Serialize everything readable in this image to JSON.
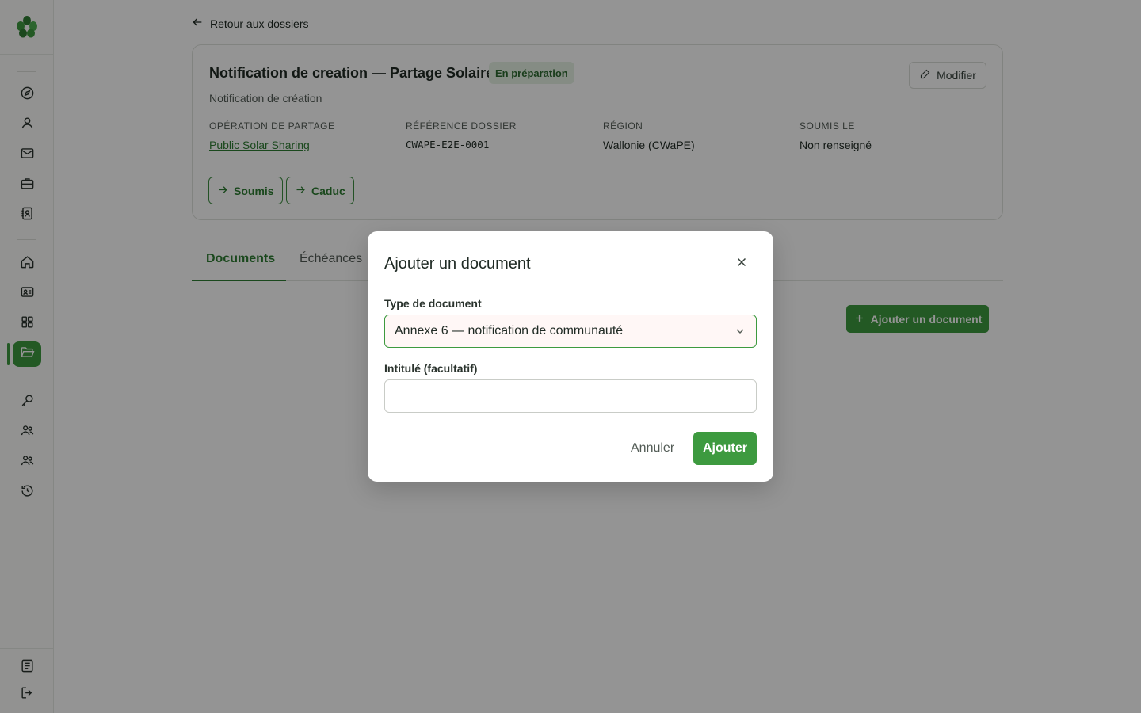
{
  "back_link": {
    "label": "Retour aux dossiers"
  },
  "dossier": {
    "title": "Notification de creation — Partage Solaire",
    "status": "En préparation",
    "subtitle": "Notification de création",
    "edit_label": "Modifier",
    "meta": [
      {
        "label": "Opération de partage",
        "value": "Public Solar Sharing"
      },
      {
        "label": "Référence dossier",
        "value": "CWAPE-E2E-0001"
      },
      {
        "label": "Région",
        "value": "Wallonie (CWaPE)"
      },
      {
        "label": "Soumis le",
        "value": "Non renseigné"
      }
    ],
    "transitions": [
      "Soumis",
      "Caduc"
    ]
  },
  "tabs": [
    {
      "label": "Documents",
      "active": true
    },
    {
      "label": "Échéances",
      "active": false
    }
  ],
  "add_document_button": "Ajouter un document",
  "modal": {
    "title": "Ajouter un document",
    "type_label": "Type de document",
    "type_value": "Annexe 6 — notification de communauté",
    "name_label": "Intitulé (facultatif)",
    "name_value": "",
    "cancel_label": "Annuler",
    "submit_label": "Ajouter"
  },
  "sidebar": {
    "icons": [
      "compass-icon",
      "user-icon",
      "mail-icon",
      "briefcase-icon",
      "contact-book-icon",
      "home-icon",
      "id-card-icon",
      "grid-icon",
      "folder-open-icon",
      "key-icon",
      "users-icon",
      "users-icon",
      "history-icon",
      "document-list-icon",
      "logout-icon"
    ],
    "active": "folder-open-icon"
  },
  "colors": {
    "brand": "#3d9a3f",
    "brand_text": "#2e7d32",
    "badge_bg": "#e6f1e4",
    "overlay": "rgba(0,0,0,0.42)"
  }
}
